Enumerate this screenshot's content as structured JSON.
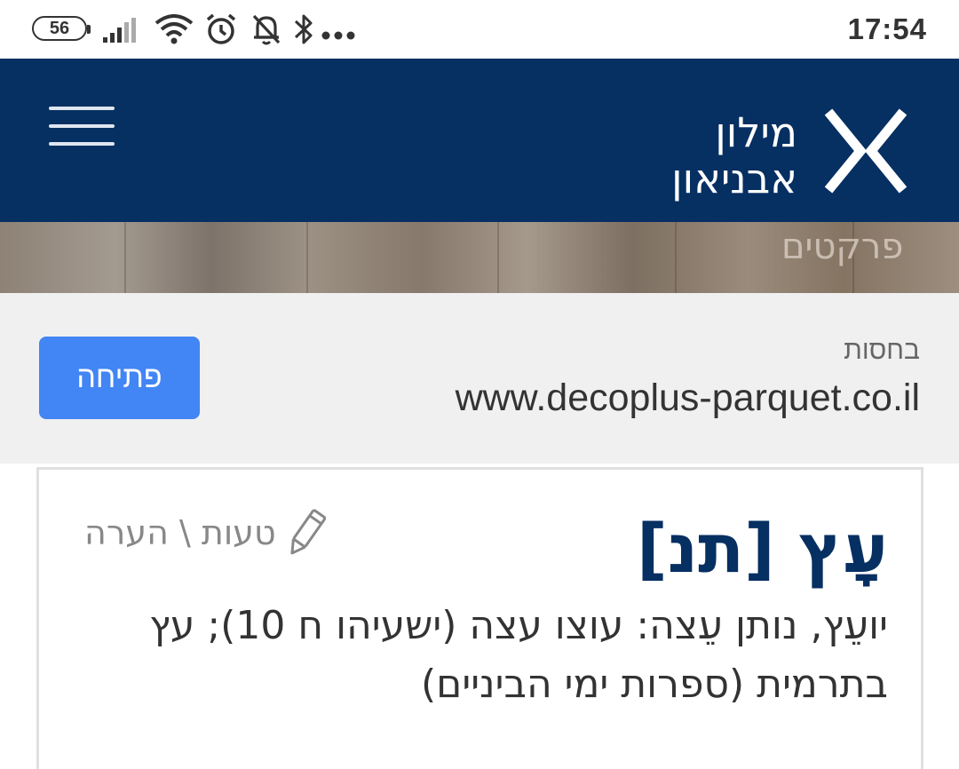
{
  "status_bar": {
    "battery": "56",
    "time": "17:54",
    "icons": [
      "signal-icon",
      "wifi-icon",
      "alarm-icon",
      "notifications-off-icon",
      "bluetooth-icon",
      "more-dots-icon"
    ]
  },
  "header": {
    "logo_line1": "מילון",
    "logo_line2": "אבניאון",
    "menu_icon": "hamburger-menu-icon",
    "background": "#062f62"
  },
  "ad": {
    "image_text": "פרקטים",
    "label": "בחסות",
    "url": "www.decoplus-parquet.co.il",
    "open_button": "פתיחה",
    "button_color": "#4285f4"
  },
  "entry": {
    "title": "עָץ [תנ]",
    "report_link": "טעות \\ הערה",
    "report_icon": "pencil-icon",
    "definition_line1": "יועֵץ, נותן עֵצה: עוצו עצה (ישעיהו ח 10); עץ",
    "definition_line2": "בתרמית (ספרות ימי הביניים)"
  }
}
